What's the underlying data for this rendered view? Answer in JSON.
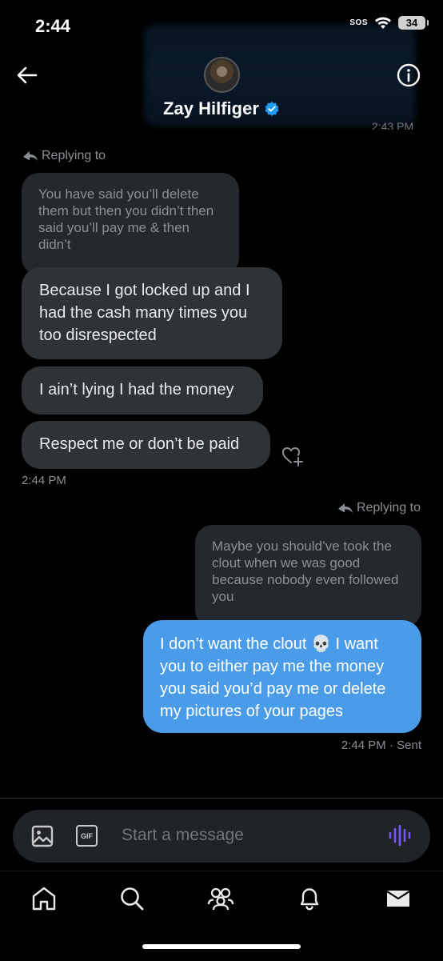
{
  "status_bar": {
    "time": "2:44",
    "sos": "SOS",
    "battery": "34"
  },
  "header": {
    "contact_name": "Zay Hilfiger",
    "peek_time": "2:43 PM"
  },
  "messages": {
    "incoming_reply_label": "Replying to",
    "incoming_quote": "You have said you’ll delete them but then you didn’t then said you’ll pay me & then didn’t",
    "incoming": [
      "Because I got locked up and I had the cash many times you too disrespected",
      "I ain’t lying I had the money",
      "Respect me or don’t be paid"
    ],
    "incoming_time": "2:44 PM",
    "outgoing_reply_label": "Replying to",
    "outgoing_quote": "Maybe you should’ve took the clout when we was good because nobody even followed you",
    "outgoing": "I don’t want the clout 💀 I want you to either pay me the money you said you’d pay me or delete my pictures of your pages",
    "outgoing_time": "2:44 PM",
    "outgoing_status": "· Sent"
  },
  "composer": {
    "placeholder": "Start a message",
    "gif_label": "GIF"
  },
  "tabs": [
    "home-icon",
    "search-icon",
    "communities-icon",
    "notifications-icon",
    "messages-icon"
  ],
  "colors": {
    "accent": "#4a9be8",
    "voice": "#7856ff",
    "bubble_in": "#2f3336"
  }
}
